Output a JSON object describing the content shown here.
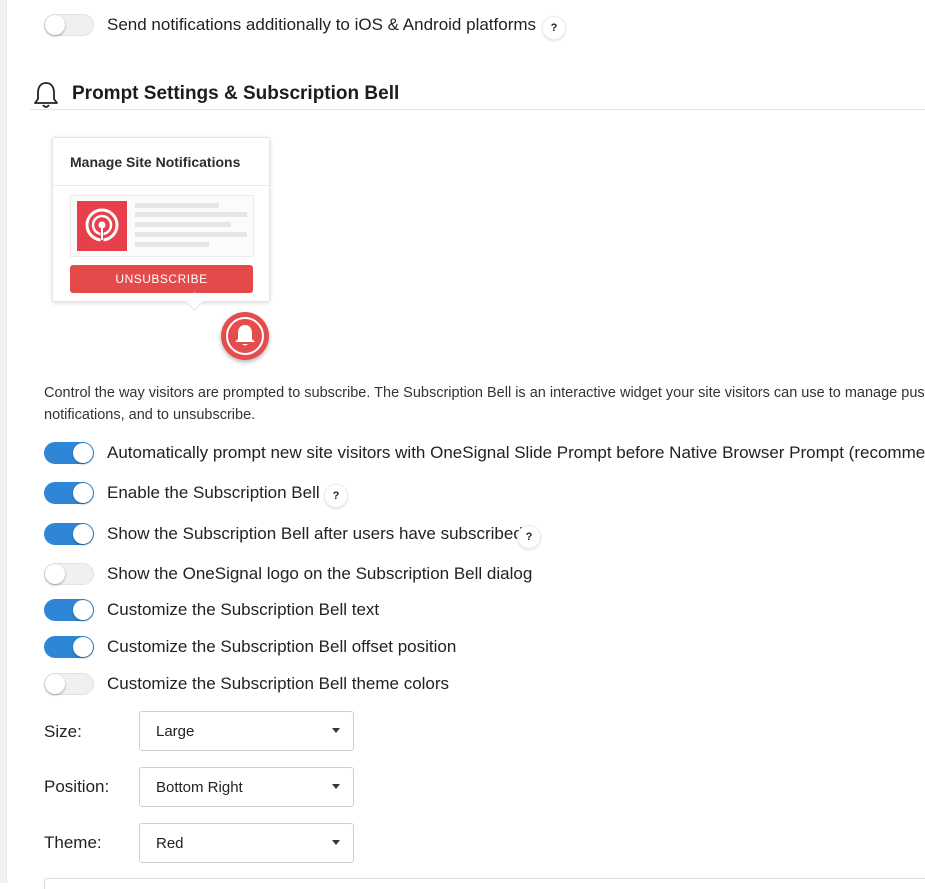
{
  "notifications": {
    "mobile_toggle": {
      "label": "Send notifications additionally to iOS & Android platforms",
      "state": "off",
      "help": "?"
    }
  },
  "section": {
    "title": "Prompt Settings & Subscription Bell",
    "icon": "bell-outline-icon"
  },
  "preview": {
    "dialog_title": "Manage Site Notifications",
    "unsubscribe_label": "UNSUBSCRIBE",
    "brand_color": "#e44a4a"
  },
  "description": "Control the way visitors are prompted to subscribe. The Subscription Bell is an interactive widget your site visitors can use to manage push notifications, and to unsubscribe.",
  "toggles": [
    {
      "label": "Automatically prompt new site visitors with OneSignal Slide Prompt before Native Browser Prompt (recommended)",
      "state": "on",
      "help": ""
    },
    {
      "label": "Enable the Subscription Bell",
      "state": "on",
      "help": "?"
    },
    {
      "label": "Show the Subscription Bell after users have subscribed",
      "state": "on",
      "help": "?"
    },
    {
      "label": "Show the OneSignal logo on the Subscription Bell dialog",
      "state": "off",
      "help": ""
    },
    {
      "label": "Customize the Subscription Bell text",
      "state": "on",
      "help": ""
    },
    {
      "label": "Customize the Subscription Bell offset position",
      "state": "on",
      "help": ""
    },
    {
      "label": "Customize the Subscription Bell theme colors",
      "state": "off",
      "help": ""
    }
  ],
  "form": {
    "size": {
      "label": "Size:",
      "value": "Large"
    },
    "position": {
      "label": "Position:",
      "value": "Bottom Right"
    },
    "theme": {
      "label": "Theme:",
      "value": "Red"
    }
  },
  "colors": {
    "toggle_on": "#2f86d6",
    "accent_red": "#e54c4c"
  }
}
